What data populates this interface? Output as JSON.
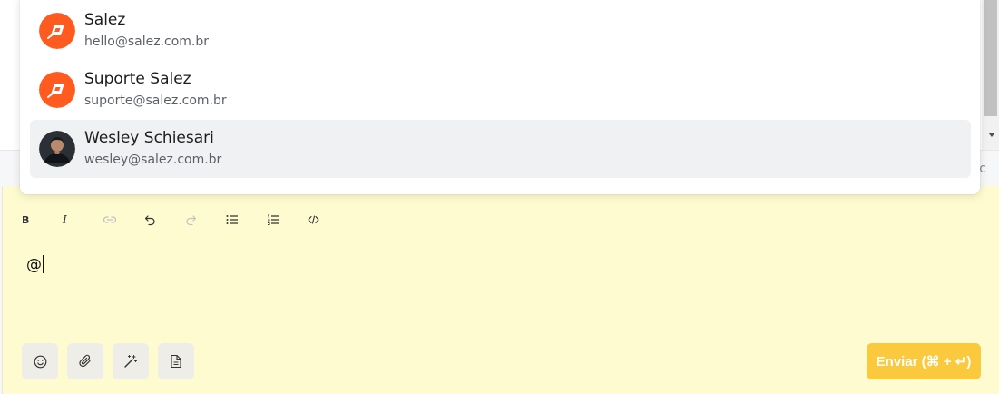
{
  "mention_list": {
    "items": [
      {
        "name": "Salez",
        "email": "hello@salez.com.br",
        "avatar": "salez-logo-icon"
      },
      {
        "name": "Suporte Salez",
        "email": "suporte@salez.com.br",
        "avatar": "salez-logo-icon"
      },
      {
        "name": "Wesley Schiesari",
        "email": "wesley@salez.com.br",
        "avatar": "user-photo"
      }
    ]
  },
  "toolbar": {
    "bold_label": "B",
    "italic_label": "I",
    "buttons": [
      "bold-icon",
      "italic-icon",
      "link-icon",
      "undo-icon",
      "redo-icon",
      "bullet-list-icon",
      "ordered-list-icon",
      "code-icon"
    ]
  },
  "editor": {
    "text": "@"
  },
  "actions": {
    "tools": [
      "emoji-icon",
      "attachment-icon",
      "magic-wand-icon",
      "document-icon"
    ],
    "send_label": "Enviar (⌘ + ↵)"
  },
  "colors": {
    "brand_orange": "#ff5a1f",
    "composer_bg": "#fefbd0",
    "send_bg": "#fbc93d"
  },
  "side_glyph": "c"
}
